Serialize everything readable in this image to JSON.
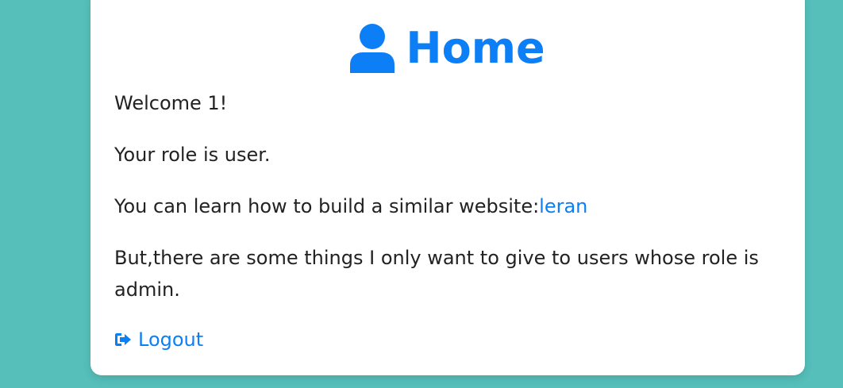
{
  "header": {
    "title": "Home",
    "icon": "user-icon"
  },
  "content": {
    "welcome": "Welcome 1!",
    "role": "Your role is user.",
    "learn_text": "You can learn how to build a similar website:",
    "learn_link": "leran",
    "admin_text": "But,there are some things I only want to give to users whose role is admin."
  },
  "logout": {
    "label": "Logout",
    "icon": "sign-out-icon"
  },
  "colors": {
    "background": "#56bfba",
    "accent": "#0d7ff6",
    "card": "#ffffff",
    "text": "#222222"
  }
}
